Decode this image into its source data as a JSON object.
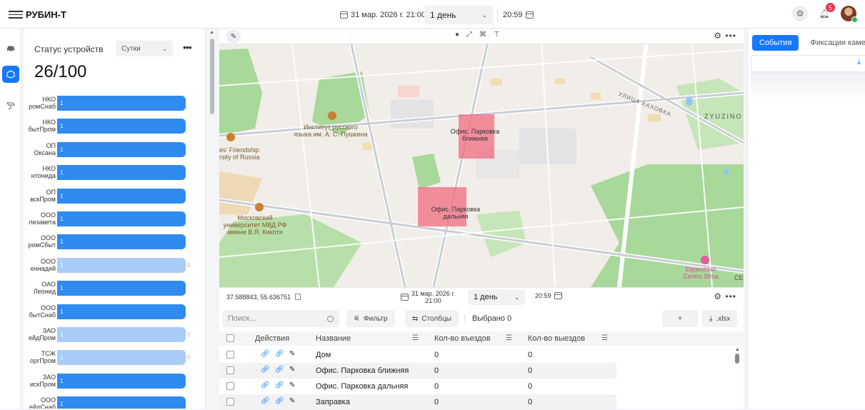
{
  "app": {
    "brand": "РУБИН-Т"
  },
  "topbar": {
    "date": "31 мар. 2026 г. 21:00",
    "period": "1 день",
    "time": "20:59",
    "notifications_count": "5",
    "icons": [
      "menu-icon",
      "calendar-icon",
      "chevron-down-icon",
      "settings-icon",
      "bell-icon",
      "avatar"
    ]
  },
  "rail": {
    "items": [
      "car-icon",
      "geofence-icon",
      "camera-icon"
    ],
    "active": 1
  },
  "device_status": {
    "title": "Статус устройств",
    "period": "Сутки",
    "more": "•••",
    "count": "26/100",
    "rows": [
      {
        "l1": "НКО",
        "l2": "ромСнаб",
        "value": "1",
        "fill": 1,
        "zero": ""
      },
      {
        "l1": "НКО",
        "l2": "бытПром",
        "value": "1",
        "fill": 1,
        "zero": ""
      },
      {
        "l1": "ОП",
        "l2": "Оксана",
        "value": "1",
        "fill": 1,
        "zero": ""
      },
      {
        "l1": "НКО",
        "l2": "нтонида",
        "value": "1",
        "fill": 1,
        "zero": ""
      },
      {
        "l1": "ОП",
        "l2": "вскПром",
        "value": "1",
        "fill": 1,
        "zero": ""
      },
      {
        "l1": "ООО",
        "l2": "лизавета",
        "value": "1",
        "fill": 1,
        "zero": ""
      },
      {
        "l1": "ООО",
        "l2": "ромСбыт",
        "value": "1",
        "fill": 1,
        "zero": ""
      },
      {
        "l1": "ООО",
        "l2": "еннадий",
        "value": "1",
        "fill": 1,
        "light": true,
        "zero": "0"
      },
      {
        "l1": "ОАО",
        "l2": "Леонид",
        "value": "1",
        "fill": 1,
        "zero": ""
      },
      {
        "l1": "ООО",
        "l2": "бытСнаб",
        "value": "1",
        "fill": 1,
        "zero": ""
      },
      {
        "l1": "ЗАО",
        "l2": "ейдПром",
        "value": "1",
        "fill": 1,
        "light": true,
        "zero": "0"
      },
      {
        "l1": "ТСЖ",
        "l2": "оргПром",
        "value": "1",
        "fill": 1,
        "light": true,
        "zero": "0"
      },
      {
        "l1": "ЗАО",
        "l2": "искПром",
        "value": "1",
        "fill": 1,
        "zero": ""
      },
      {
        "l1": "ООО",
        "l2": "ейдСнаб",
        "value": "1",
        "fill": 1,
        "zero": ""
      }
    ]
  },
  "map": {
    "tools": [
      "pin-icon",
      "line-icon",
      "polygon-icon",
      "ruler-icon"
    ],
    "labels": {
      "pushkin": [
        "Институт русского",
        "языка им. А. С. Пушкина"
      ],
      "friendship": [
        "es' Friendship",
        "rsity of Russia"
      ],
      "mvd": [
        "Московский",
        "университет МВД РФ",
        "имени В.Я. Кикотя"
      ],
      "street": "УЛИЦА КАХОВКА",
      "zyuzino": "ZYUZINO",
      "equestrian": [
        "Equestrian",
        "Centre Bitsa"
      ],
      "ce": "СЕ",
      "parking_near": [
        "Офис. Парковка",
        "ближняя"
      ],
      "parking_far": [
        "Офис. Парковка",
        "дальняя"
      ]
    }
  },
  "map_footer": {
    "coords": "37.588843, 55.636751",
    "date_l1": "31 мар. 2026 г.",
    "date_l2": "21:00",
    "period": "1 день",
    "time": "20:59"
  },
  "table": {
    "search_placeholder": "Поиск...",
    "filter_label": "Фильтр",
    "columns_label": "Столбцы",
    "selected_text": "Выбрано 0",
    "add_label": "+",
    "export_label": ".xlsx",
    "headers": {
      "actions": "Действия",
      "name": "Название",
      "entries": "Кол-во въездов",
      "exits": "Кол-во выездов"
    },
    "rows": [
      {
        "name": "Дом",
        "entries": "0",
        "exits": "0"
      },
      {
        "name": "Офис. Парковка ближняя",
        "entries": "0",
        "exits": "0"
      },
      {
        "name": "Офис. Парковка дальняя",
        "entries": "0",
        "exits": "0"
      },
      {
        "name": "Заправка",
        "entries": "0",
        "exits": "0"
      }
    ]
  },
  "right_panel": {
    "tabs": [
      "События",
      "Фиксации камер"
    ],
    "active_tab": 0
  },
  "colors": {
    "accent": "#1677ff",
    "bar": "#2f8bf0",
    "bar_light": "#a9ccf6",
    "geofence": "#f06b82",
    "park": "#a8d89a"
  }
}
